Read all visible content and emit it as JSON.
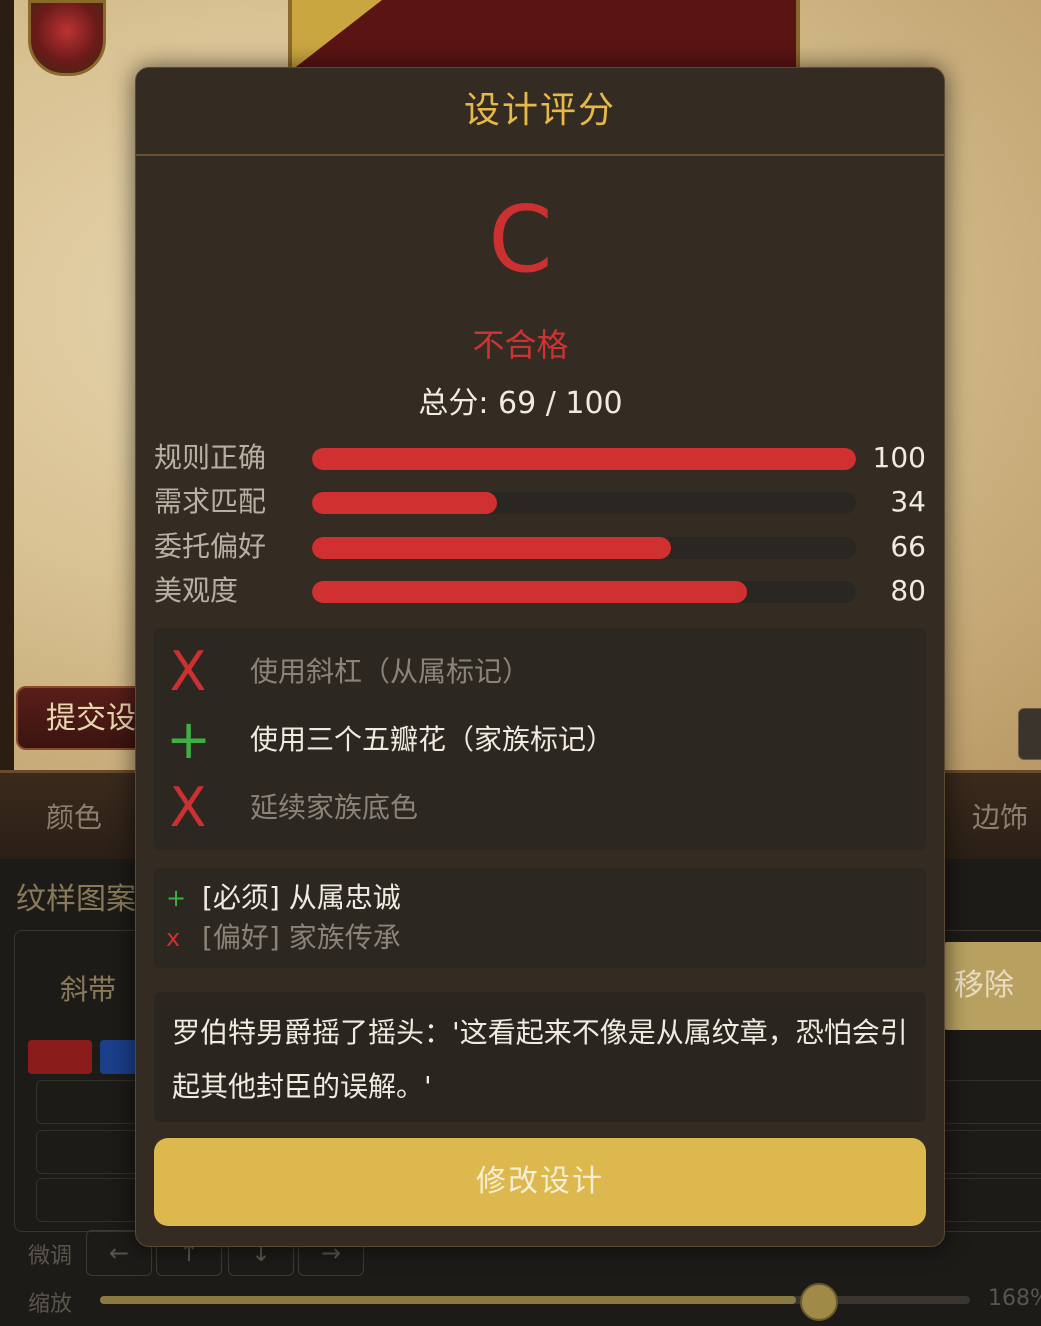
{
  "background": {
    "submit_button": "提交设",
    "tabs": {
      "color": "颜色",
      "border": "边饰"
    },
    "pattern_section_title": "纹样图案",
    "pattern_item": "斜带",
    "remove_button": "移除",
    "nudge_label": "微调",
    "nudge_arrows": [
      "←",
      "↑",
      "↓",
      "→"
    ],
    "zoom_label": "缩放",
    "zoom_value": "168%",
    "zoom_level": 0.8,
    "swatch_colors": [
      "#8a1c1c",
      "#1c3f8a"
    ]
  },
  "modal": {
    "title": "设计评分",
    "grade": "C",
    "verdict": "不合格",
    "total": "总分: 69 / 100",
    "scores": [
      {
        "label": "规则正确",
        "value": "100",
        "fraction": 1.0
      },
      {
        "label": "需求匹配",
        "value": "34",
        "fraction": 0.34
      },
      {
        "label": "委托偏好",
        "value": "66",
        "fraction": 0.66
      },
      {
        "label": "美观度",
        "value": "80",
        "fraction": 0.8
      }
    ],
    "elements": [
      {
        "mark": "X",
        "text": "使用斜杠（从属标记）",
        "status": "missing"
      },
      {
        "mark": "+",
        "text": "使用三个五瓣花（家族标记）",
        "status": "met"
      },
      {
        "mark": "X",
        "text": "延续家族底色",
        "status": "missing"
      }
    ],
    "requirements": [
      {
        "mark": "+",
        "text": "[必须] 从属忠诚",
        "status": "met"
      },
      {
        "mark": "x",
        "text": "[偏好] 家族传承",
        "status": "missing"
      }
    ],
    "quote": "罗伯特男爵摇了摇头：'这看起来不像是从属纹章，恐怕会引起其他封臣的误解。'",
    "revise_button": "修改设计"
  },
  "colors": {
    "accent_gold": "#e6b84a",
    "fail_red": "#cc3030",
    "pass_green": "#3cb043",
    "button_yellow": "#dcb84e"
  }
}
